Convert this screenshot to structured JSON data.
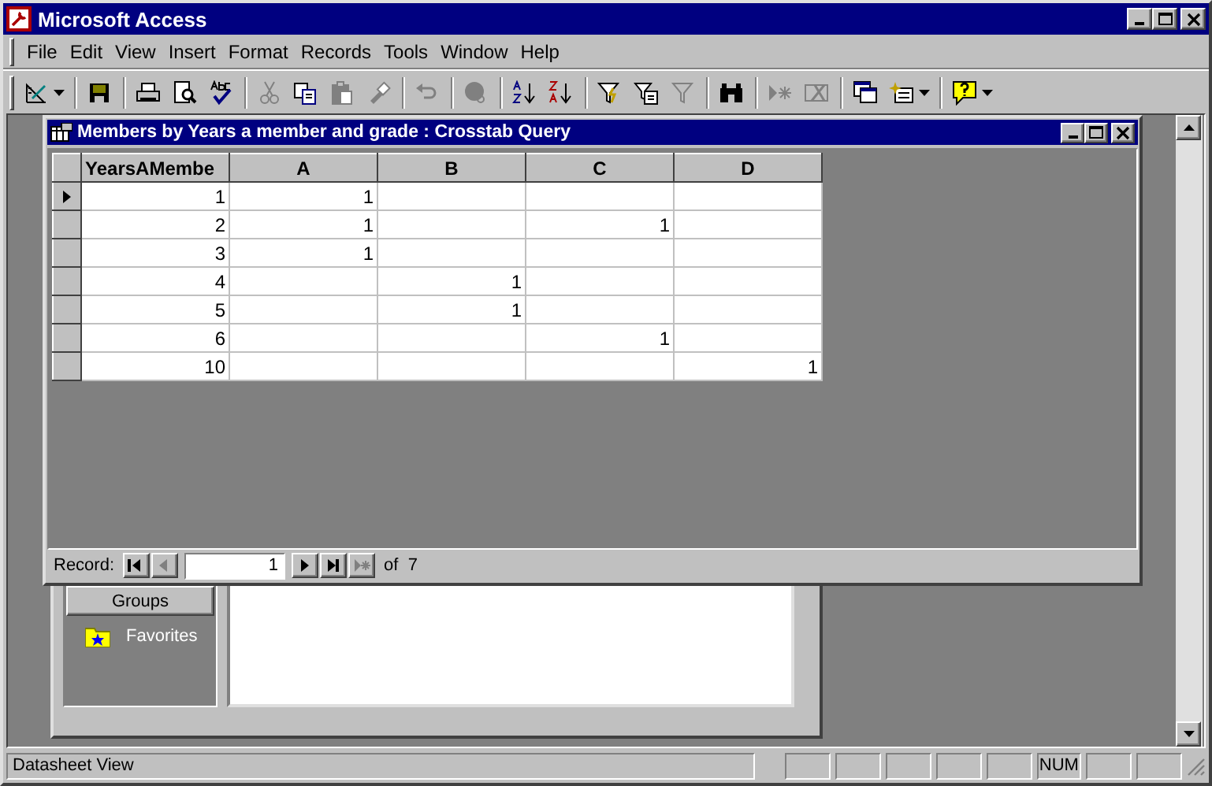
{
  "window": {
    "title": "Microsoft Access"
  },
  "menu": [
    {
      "label": "File"
    },
    {
      "label": "Edit"
    },
    {
      "label": "View"
    },
    {
      "label": "Insert"
    },
    {
      "label": "Format"
    },
    {
      "label": "Records"
    },
    {
      "label": "Tools"
    },
    {
      "label": "Window"
    },
    {
      "label": "Help"
    }
  ],
  "toolbar": [
    {
      "kind": "view",
      "disabled": false,
      "dropdown": true
    },
    {
      "kind": "sep"
    },
    {
      "kind": "save",
      "disabled": false,
      "dropdown": false
    },
    {
      "kind": "sep"
    },
    {
      "kind": "print",
      "disabled": false,
      "dropdown": false
    },
    {
      "kind": "preview",
      "disabled": false,
      "dropdown": false
    },
    {
      "kind": "spelling",
      "disabled": false,
      "dropdown": false
    },
    {
      "kind": "sep"
    },
    {
      "kind": "cut",
      "disabled": true,
      "dropdown": false
    },
    {
      "kind": "copy",
      "disabled": false,
      "dropdown": false
    },
    {
      "kind": "paste",
      "disabled": true,
      "dropdown": false
    },
    {
      "kind": "painter",
      "disabled": true,
      "dropdown": false
    },
    {
      "kind": "sep"
    },
    {
      "kind": "undo",
      "disabled": true,
      "dropdown": false
    },
    {
      "kind": "sep"
    },
    {
      "kind": "hyperlink",
      "disabled": true,
      "dropdown": false
    },
    {
      "kind": "sep"
    },
    {
      "kind": "sort-asc",
      "disabled": false,
      "dropdown": false
    },
    {
      "kind": "sort-desc",
      "disabled": false,
      "dropdown": false
    },
    {
      "kind": "sep"
    },
    {
      "kind": "filter-selection",
      "disabled": false,
      "dropdown": false
    },
    {
      "kind": "filter-form",
      "disabled": false,
      "dropdown": false
    },
    {
      "kind": "filter-apply",
      "disabled": true,
      "dropdown": false
    },
    {
      "kind": "sep"
    },
    {
      "kind": "find",
      "disabled": false,
      "dropdown": false
    },
    {
      "kind": "sep"
    },
    {
      "kind": "new-record",
      "disabled": true,
      "dropdown": false
    },
    {
      "kind": "delete-record",
      "disabled": true,
      "dropdown": false
    },
    {
      "kind": "sep"
    },
    {
      "kind": "database-window",
      "disabled": false,
      "dropdown": false
    },
    {
      "kind": "new-object",
      "disabled": false,
      "dropdown": true
    },
    {
      "kind": "sep"
    },
    {
      "kind": "help",
      "disabled": false,
      "dropdown": true
    }
  ],
  "query_window": {
    "title": "Members by Years a member and grade : Crosstab Query",
    "columns": [
      "YearsAMembe",
      "A",
      "B",
      "C",
      "D"
    ],
    "rows": [
      {
        "current": true,
        "cells": [
          "1",
          "1",
          null,
          null,
          null
        ]
      },
      {
        "current": false,
        "cells": [
          "2",
          "1",
          null,
          "1",
          null
        ]
      },
      {
        "current": false,
        "cells": [
          "3",
          "1",
          null,
          null,
          null
        ]
      },
      {
        "current": false,
        "cells": [
          "4",
          null,
          "1",
          null,
          null
        ]
      },
      {
        "current": false,
        "cells": [
          "5",
          null,
          "1",
          null,
          null
        ]
      },
      {
        "current": false,
        "cells": [
          "6",
          null,
          null,
          "1",
          null
        ]
      },
      {
        "current": false,
        "cells": [
          "10",
          null,
          null,
          null,
          "1"
        ]
      }
    ],
    "navigation": {
      "label": "Record:",
      "value": "1",
      "total": "of  7",
      "buttons": [
        {
          "kind": "first",
          "disabled": false
        },
        {
          "kind": "prev",
          "disabled": true
        }
      ],
      "buttons_after": [
        {
          "kind": "next",
          "disabled": false
        },
        {
          "kind": "last",
          "disabled": false
        },
        {
          "kind": "new",
          "disabled": true
        }
      ]
    }
  },
  "database_window": {
    "groups_button": "Groups",
    "groups": [
      {
        "label": "Favorites"
      }
    ]
  },
  "status_bar": {
    "message": "Datasheet View",
    "indicator": "NUM"
  }
}
